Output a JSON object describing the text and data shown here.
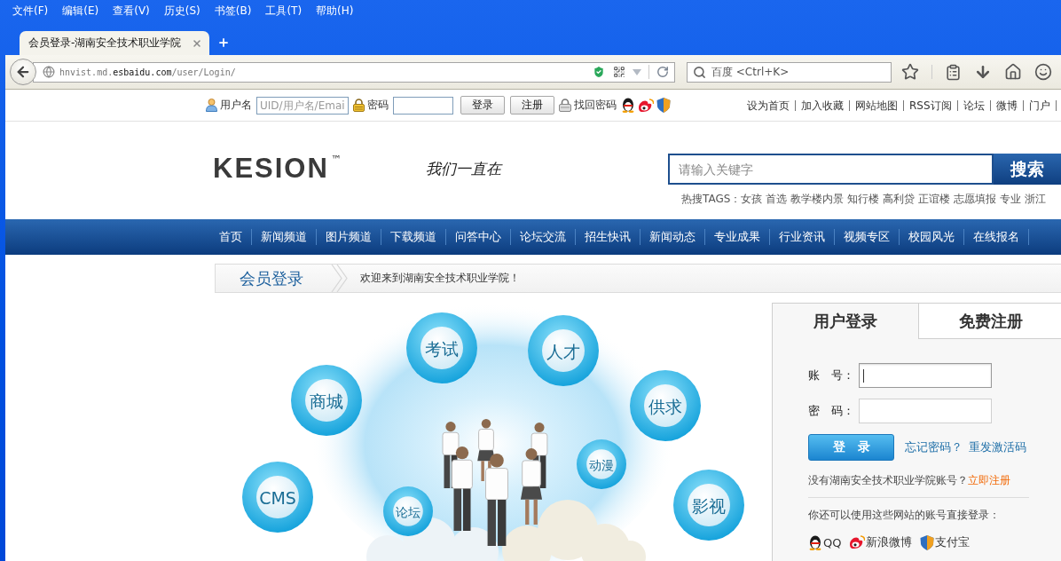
{
  "menu_bar": [
    "文件(F)",
    "编辑(E)",
    "查看(V)",
    "历史(S)",
    "书签(B)",
    "工具(T)",
    "帮助(H)"
  ],
  "browser_tabs": [
    {
      "title": "会员登录-湖南安全技术职业学院",
      "selected": true
    }
  ],
  "address_bar": {
    "url": "hnvist.md.**esbaidu.com**/user/Login/"
  },
  "browser_search": {
    "placeholder": "百度 <Ctrl+K>"
  },
  "top_bar": {
    "username_label": "用户名",
    "username_placeholder": "UID/用户名/Emai",
    "password_label": "密码",
    "buttons": [
      "登录",
      "注册"
    ],
    "recover_link": "找回密码",
    "links": [
      "设为首页",
      "加入收藏",
      "网站地图",
      "RSS订阅",
      "论坛",
      "微博",
      "门户"
    ]
  },
  "header": {
    "logo": "KESION",
    "trademark": "™",
    "slogan": "我们一直在",
    "search_placeholder": "请输入关键字",
    "search_button": "搜索",
    "hot_tags_label": "热搜TAGS：",
    "hot_tags": [
      "女孩",
      "首选",
      "教学楼内景",
      "知行楼",
      "高利贷",
      "正谊楼",
      "志愿填报",
      "专业",
      "浙江"
    ]
  },
  "main_nav": [
    "首页",
    "新闻频道",
    "图片频道",
    "下载频道",
    "问答中心",
    "论坛交流",
    "招生快讯",
    "新闻动态",
    "专业成果",
    "行业资讯",
    "视频专区",
    "校园风光",
    "在线报名"
  ],
  "breadcrumb": {
    "title": "会员登录",
    "welcome": "欢迎来到湖南安全技术职业学院！"
  },
  "illustration": {
    "bubbles": [
      "考试",
      "人才",
      "商城",
      "供求",
      "动漫",
      "CMS",
      "论坛",
      "影视"
    ]
  },
  "login_panel": {
    "tabs": [
      {
        "label": "用户登录",
        "selected": true
      },
      {
        "label": "免费注册",
        "selected": false
      }
    ],
    "fields": [
      {
        "label": "账　号：",
        "focused": true
      },
      {
        "label": "密　码：",
        "focused": false
      }
    ],
    "submit": "登　录",
    "links": [
      "忘记密码？",
      "重发激活码"
    ],
    "register_prompt": "没有湖南安全技术职业学院账号？",
    "register_link": "立即注册",
    "social_prompt": "你还可以使用这些网站的账号直接登录：",
    "social_logins": [
      {
        "label": "QQ",
        "kind": "qq"
      },
      {
        "label": "新浪微博",
        "kind": "weibo"
      },
      {
        "label": "支付宝",
        "kind": "alipay"
      }
    ]
  }
}
